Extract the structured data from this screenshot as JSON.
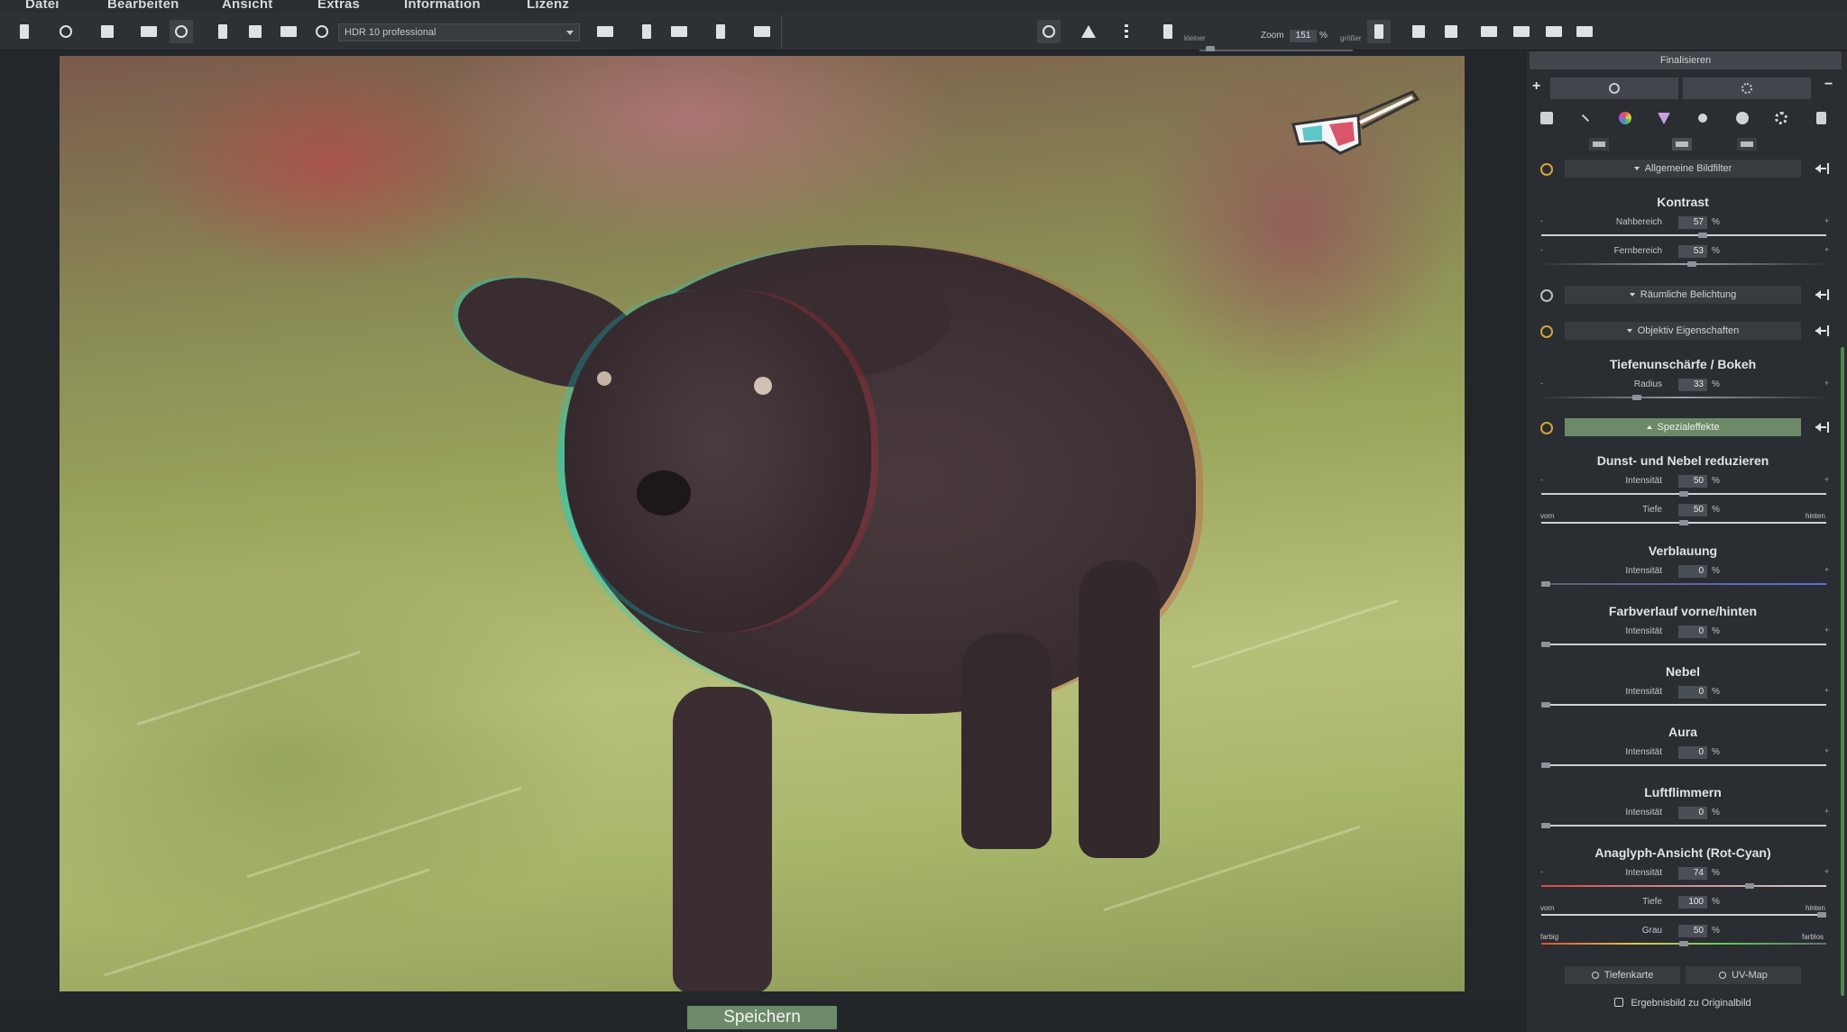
{
  "menu": [
    "Datei",
    "Bearbeiten",
    "Ansicht",
    "Extras",
    "Information",
    "Lizenz"
  ],
  "toolbar": {
    "preset_value": "HDR 10 professional",
    "zoom_label": "Zoom",
    "zoom_value": "151",
    "zoom_unit": "%",
    "zoom_smaller": "kleiner",
    "zoom_larger": "größer"
  },
  "canvas": {
    "save_label": "Speichern"
  },
  "panel": {
    "title": "Finalisieren",
    "plus": "+",
    "minus": "−",
    "sections": [
      {
        "label": "Allgemeine Bildfilter",
        "active": false
      },
      {
        "label": "Räumliche Belichtung",
        "active": false
      },
      {
        "label": "Objektiv Eigenschaften",
        "active": false
      },
      {
        "label": "Spezialeffekte",
        "active": true
      }
    ],
    "controls": {
      "kontrast": {
        "title": "Kontrast",
        "nahbereich_label": "Nahbereich",
        "nahbereich_value": "57",
        "fernbereich_label": "Fernbereich",
        "fernbereich_value": "53"
      },
      "bokeh": {
        "title": "Tiefenunschärfe / Bokeh",
        "radius_label": "Radius",
        "radius_value": "33"
      },
      "dunst": {
        "title": "Dunst- und Nebel reduzieren",
        "intensitaet_label": "Intensität",
        "intensitaet_value": "50",
        "tiefe_label": "Tiefe",
        "tiefe_value": "50",
        "left": "vorn",
        "right": "hinten"
      },
      "verblauung": {
        "title": "Verblauung",
        "intensitaet_label": "Intensität",
        "intensitaet_value": "0"
      },
      "farbverlauf": {
        "title": "Farbverlauf vorne/hinten",
        "intensitaet_label": "Intensität",
        "intensitaet_value": "0"
      },
      "nebel": {
        "title": "Nebel",
        "intensitaet_label": "Intensität",
        "intensitaet_value": "0"
      },
      "aura": {
        "title": "Aura",
        "intensitaet_label": "Intensität",
        "intensitaet_value": "0"
      },
      "luftflimmern": {
        "title": "Luftflimmern",
        "intensitaet_label": "Intensität",
        "intensitaet_value": "0"
      },
      "anaglyph": {
        "title": "Anaglyph-Ansicht (Rot-Cyan)",
        "intensitaet_label": "Intensität",
        "intensitaet_value": "74",
        "tiefe_label": "Tiefe",
        "tiefe_value": "100",
        "tiefe_left": "vorn",
        "tiefe_right": "hinten",
        "grau_label": "Grau",
        "grau_value": "50",
        "grau_left": "farbig",
        "grau_right": "farblos"
      }
    },
    "pct": "%",
    "slider_minus": "-",
    "slider_plus": "+",
    "depth_map_label": "Tiefenkarte",
    "uv_map_label": "UV-Map",
    "result_label": "Ergebnisbild zu Originalbild"
  },
  "colors": {
    "accent_green": "#6c8a68",
    "toggle_yellow": "#d1a53a",
    "panel_bg": "#2a2d31"
  }
}
